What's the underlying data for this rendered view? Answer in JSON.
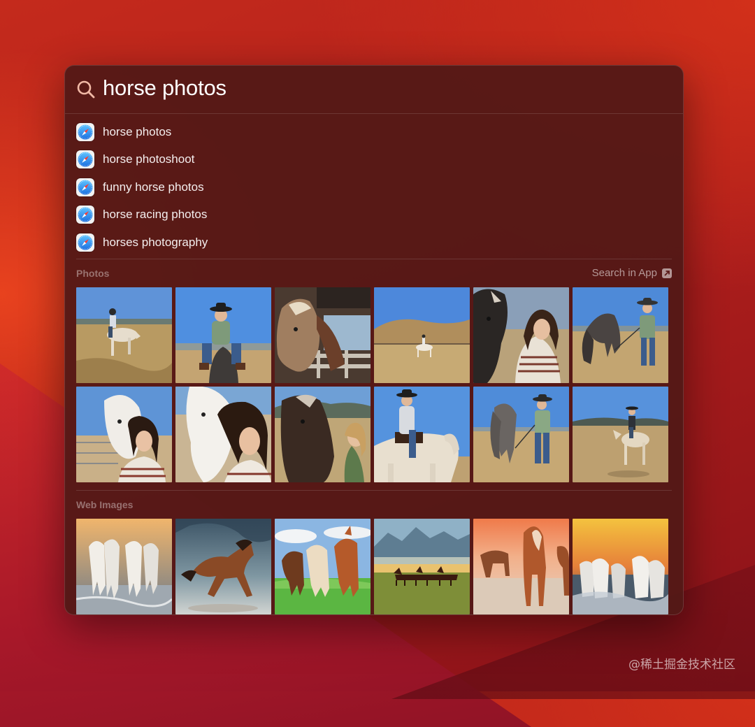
{
  "search": {
    "query": "horse photos"
  },
  "suggestions": [
    {
      "label": "horse photos",
      "icon": "safari-icon"
    },
    {
      "label": "horse photoshoot",
      "icon": "safari-icon"
    },
    {
      "label": "funny horse photos",
      "icon": "safari-icon"
    },
    {
      "label": "horse racing photos",
      "icon": "safari-icon"
    },
    {
      "label": "horses photography",
      "icon": "safari-icon"
    }
  ],
  "photos": {
    "title": "Photos",
    "action_label": "Search in App",
    "action_icon": "arrow-up-right-icon",
    "items": [
      "photo-girl-riding-pale-horse",
      "photo-girl-cowboy-hat-on-horse",
      "photo-horse-in-stable",
      "photo-rider-in-hills",
      "photo-girl-with-black-horse",
      "photo-girl-leading-horse",
      "photo-girl-hugging-white-horse",
      "photo-girl-cheek-to-white-horse",
      "photo-girl-petting-dark-horse",
      "photo-girl-riding-cream-horse",
      "photo-girl-with-grazing-horse",
      "photo-girl-riding-in-field"
    ]
  },
  "web_images": {
    "title": "Web Images",
    "items": [
      "web-white-horses-running-water",
      "web-brown-horse-galloping",
      "web-three-horses-meadow",
      "web-herd-under-mountains",
      "web-horses-beach-sunset",
      "web-white-horses-splashing"
    ]
  },
  "watermark": "@稀土掘金技术社区",
  "colors": {
    "panel": "#521816",
    "accent_sky": "#5b8fd6",
    "text": "#ffffff"
  }
}
